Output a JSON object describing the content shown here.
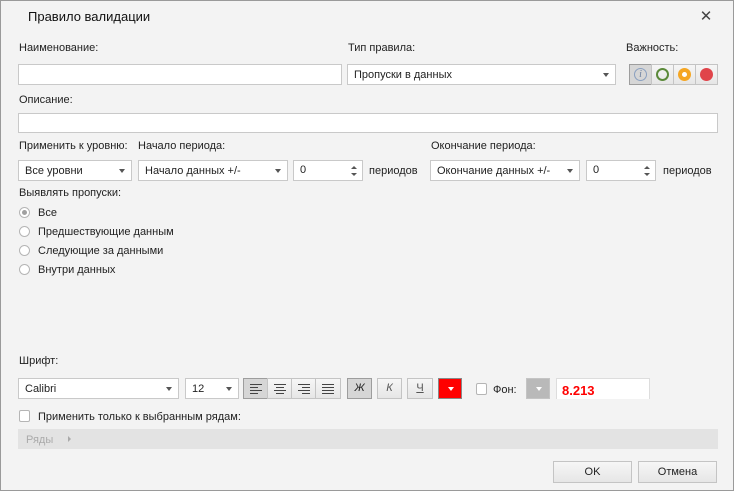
{
  "title": "Правило валидации",
  "name": {
    "label": "Наименование:",
    "value": ""
  },
  "rule_type": {
    "label": "Тип правила:",
    "value": "Пропуски в данных"
  },
  "importance": {
    "label": "Важность:",
    "options": [
      "info",
      "low",
      "medium",
      "high"
    ],
    "selected": "info",
    "colors": {
      "low": "#5b8a3a",
      "medium": "#f5a623",
      "high": "#e0444a",
      "info": "#8aa0c0"
    }
  },
  "description": {
    "label": "Описание:",
    "value": ""
  },
  "level": {
    "label": "Применить к уровню:",
    "value": "Все уровни"
  },
  "period_start": {
    "label": "Начало периода:",
    "value": "Начало данных +/-",
    "count": "0",
    "unit": "периодов"
  },
  "period_end": {
    "label": "Окончание периода:",
    "value": "Окончание данных +/-",
    "count": "0",
    "unit": "периодов"
  },
  "gaps": {
    "label": "Выявлять пропуски:",
    "options": [
      "Все",
      "Предшествующие данным",
      "Следующие за данными",
      "Внутри данных"
    ],
    "selected": 0
  },
  "font": {
    "label": "Шрифт:",
    "family": "Calibri",
    "size": "12",
    "bold": "Ж",
    "italic": "К",
    "underline": "Ч",
    "color": "#ff0000",
    "bg_label": "Фон:",
    "preview": "8.213"
  },
  "rows": {
    "checkbox_label": "Применить только к выбранным рядам:",
    "breadcrumb": "Ряды"
  },
  "buttons": {
    "ok": "OK",
    "cancel": "Отмена"
  }
}
